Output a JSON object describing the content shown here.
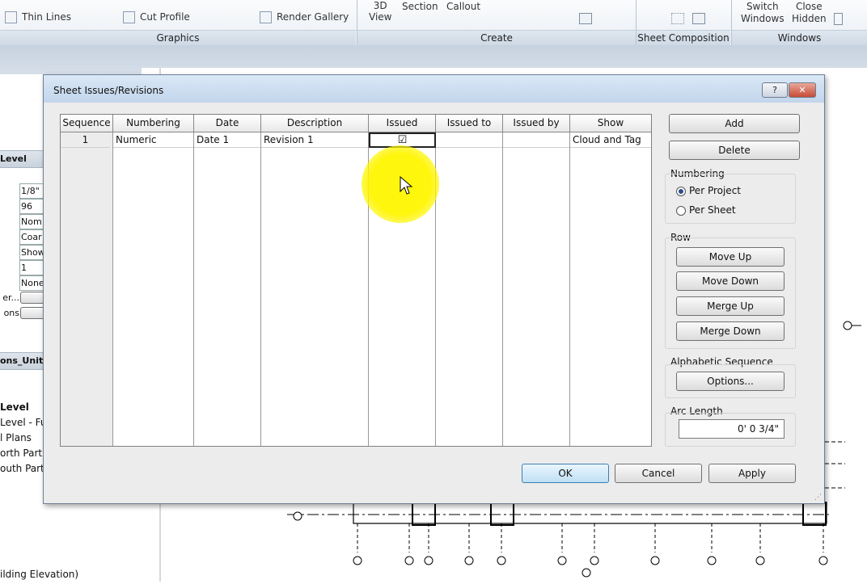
{
  "ribbon": {
    "graphics": {
      "item1": "Thin Lines",
      "item2": "Cut Profile",
      "item3": "Render Gallery",
      "title": "Graphics"
    },
    "create": {
      "view3d": "3D\nView",
      "section": "Section",
      "callout": "Callout",
      "title": "Create"
    },
    "sheet_composition": {
      "title": "Sheet Composition"
    },
    "windows": {
      "switch": "Switch\nWindows",
      "close": "Close\nHidden",
      "title": "Windows"
    }
  },
  "left_panel": {
    "props_header": "Level",
    "values": [
      "1/8\"",
      "96",
      "Nom",
      "Coar",
      "Show",
      "1",
      "None"
    ],
    "btn_labels": [
      "er...",
      "ons"
    ],
    "browser_header": "ons_Unit",
    "tree": [
      "Level",
      "Level - Fu",
      "l Plans",
      "orth Partia",
      "outh Partia"
    ],
    "bottom": "ilding Elevation)"
  },
  "dialog": {
    "title": "Sheet Issues/Revisions",
    "columns": [
      "Sequence",
      "Numbering",
      "Date",
      "Description",
      "Issued",
      "Issued to",
      "Issued by",
      "Show"
    ],
    "rows": [
      {
        "sequence": "1",
        "numbering": "Numeric",
        "date": "Date 1",
        "description": "Revision 1",
        "issued": "☑",
        "issued_to": "",
        "issued_by": "",
        "show": "Cloud and Tag"
      }
    ],
    "buttons": {
      "add": "Add",
      "delete": "Delete",
      "ok": "OK",
      "cancel": "Cancel",
      "apply": "Apply",
      "help": "?",
      "close": "✕"
    },
    "numbering": {
      "label": "Numbering",
      "per_project": "Per Project",
      "per_sheet": "Per Sheet",
      "selected": "per_project"
    },
    "row": {
      "label": "Row",
      "move_up": "Move Up",
      "move_down": "Move Down",
      "merge_up": "Merge Up",
      "merge_down": "Merge Down"
    },
    "alpha": {
      "label": "Alphabetic Sequence",
      "options": "Options..."
    },
    "arc": {
      "label": "Arc Length",
      "value": "0'  0 3/4\""
    }
  }
}
